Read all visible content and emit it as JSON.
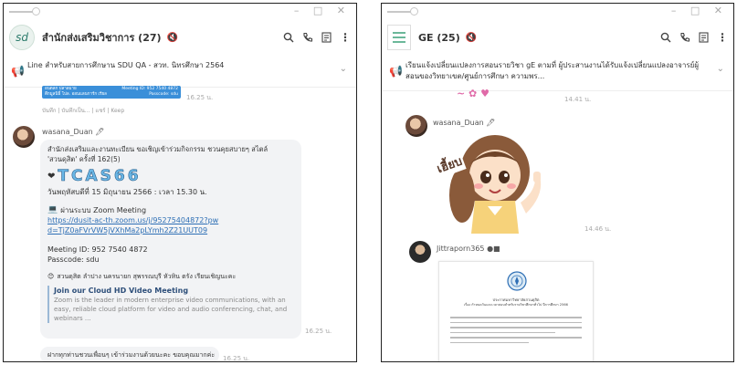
{
  "left": {
    "title": "สำนักส่งเสริมวิชาการ (27)",
    "announcement": "Line สำหรับสายการศึกษาน SDU QA - สวท. นิทรศึกษา 2564",
    "prev_card": {
      "line1": "อนตลก ปลาลมาย",
      "line2": "ตึกมูลนิธิ์ โปล. ออนแลนการ์ก เรียล",
      "meet_line1": "Meeting ID: 952 7540 4872",
      "meet_line2": "Passcode: sdu",
      "time": "16.25 น.",
      "actions": "บันทึก | บันทึกเป็น... | แชร์ | Keep"
    },
    "sender": "wasana_Duan",
    "message": {
      "intro": "สำนักส่งเสริมและงานทะเบียน ขอเชิญเข้าร่วมกิจกรรม ชวนคุยสบายๆ สไตล์ 'สวนดุสิต' ครั้งที่ 162(5)",
      "tcas": "TCAS66",
      "date": "วันพฤหัสบดีที่ 15 มิถุนายน 2566 : เวลา 15.30 น.",
      "zoom_heading": "ผ่านระบบ Zoom Meeting",
      "zoom_link": "https://dusit-ac-th.zoom.us/j/95275404872?pwd=TjZ0aFVrVW5jVXhMa2pLYmh2Z21UUT09",
      "meeting_id": "Meeting ID: 952 7540 4872",
      "passcode": "Passcode: sdu",
      "invite": "สวนดุสิต ลำปาง นครนายก สุพรรณบุรี หัวหิน ตรัง เรียนเชิญนะคะ",
      "card_title": "Join our Cloud HD Video Meeting",
      "card_desc": "Zoom is the leader in modern enterprise video communications, with an easy, reliable cloud platform for video and audio conferencing, chat, and webinars ..."
    },
    "last_message": "ฝากทุกท่านชวนเพื่อนๆ เข้าร่วมงานด้วยนะคะ ขอบคุณมากค่ะ",
    "last_time": "16.25 น."
  },
  "right": {
    "title": "GE (25)",
    "announcement": "เรียนแจ้งเปลี่ยนแปลงการสอนรายวิชา gE ตามที่ ผู้ประสานงานได้รับแจ้งเปลี่ยนแปลงอาจารย์ผู้สอนของวิทยาเขต/ศูนย์การศึกษา ความพร...",
    "prev_time": "14.41 น.",
    "sender1": "wasana_Duan",
    "sticker_text": "เฮี้ยบ",
    "sticker_time": "14.46 น.",
    "sender2": "Jittraporn365",
    "doc_heading1": "ประกาศมหาวิทยาลัยสวนดุสิต",
    "doc_heading2": "เรื่อง กำหนดวันและเวลาสอบสำหรับรายวิชาศึกษาทั่วไป ปีการศึกษา 2566"
  }
}
